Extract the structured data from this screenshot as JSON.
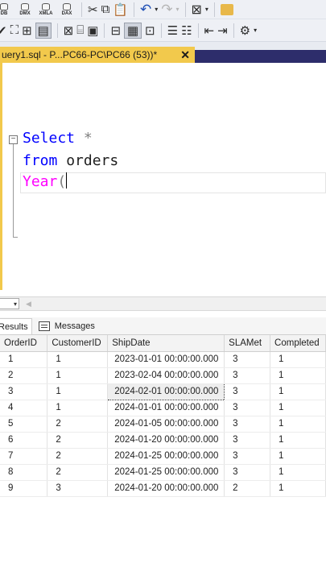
{
  "toolbar1": {
    "db_icons": [
      "DB",
      "DMX",
      "XMLA",
      "DAX"
    ]
  },
  "tab": {
    "title": "uery1.sql - P...PC66-PC\\PC66 (53))*",
    "close": "✕"
  },
  "editor": {
    "line1": {
      "kw": "Select",
      "rest": " *"
    },
    "line2": {
      "kw": "from",
      "rest": " orders"
    },
    "line3": {
      "fn": "Year",
      "rest": "("
    }
  },
  "results": {
    "tabs": {
      "results": "Results",
      "messages": "Messages"
    },
    "columns": [
      "OrderID",
      "CustomerID",
      "ShipDate",
      "SLAMet",
      "Completed"
    ],
    "rows": [
      [
        "1",
        "1",
        "2023-01-01 00:00:00.000",
        "3",
        "1"
      ],
      [
        "2",
        "1",
        "2023-02-04 00:00:00.000",
        "3",
        "1"
      ],
      [
        "3",
        "1",
        "2024-02-01 00:00:00.000",
        "3",
        "1"
      ],
      [
        "4",
        "1",
        "2024-01-01 00:00:00.000",
        "3",
        "1"
      ],
      [
        "5",
        "2",
        "2024-01-05 00:00:00.000",
        "3",
        "1"
      ],
      [
        "6",
        "2",
        "2024-01-20 00:00:00.000",
        "3",
        "1"
      ],
      [
        "7",
        "2",
        "2024-01-25 00:00:00.000",
        "3",
        "1"
      ],
      [
        "8",
        "2",
        "2024-01-25 00:00:00.000",
        "3",
        "1"
      ],
      [
        "9",
        "3",
        "2024-01-20 00:00:00.000",
        "2",
        "1"
      ]
    ],
    "selected_cell": [
      2,
      2
    ]
  },
  "colors": {
    "tab_active": "#f2c94c",
    "tab_strip": "#2d2d6b",
    "keyword": "#0000ff",
    "function": "#ff00ff"
  }
}
